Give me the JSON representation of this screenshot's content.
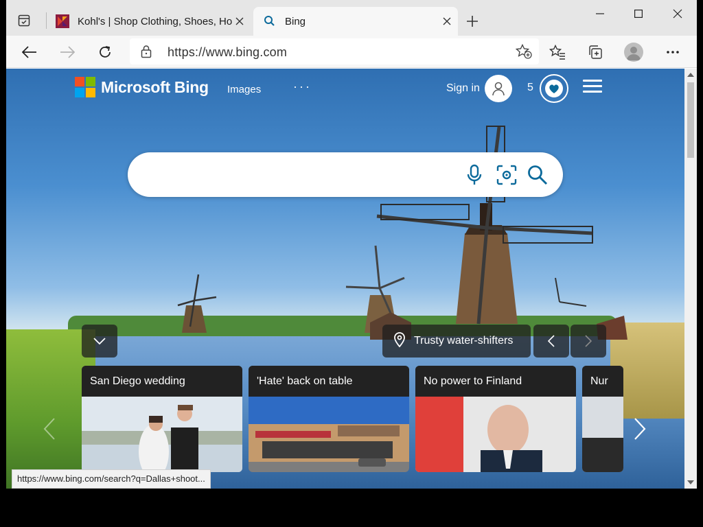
{
  "browser": {
    "tabs": [
      {
        "title": "Kohl's | Shop Clothing, Shoes, Ho",
        "active": false
      },
      {
        "title": "Bing",
        "active": true
      }
    ],
    "address": {
      "url": "https://www.bing.com"
    },
    "status_url": "https://www.bing.com/search?q=Dallas+shoot..."
  },
  "bing": {
    "brand": "Microsoft Bing",
    "nav": {
      "images": "Images",
      "more": "···"
    },
    "signin": "Sign in",
    "rewards_count": "5",
    "search": {
      "placeholder": "",
      "value": ""
    },
    "image_info": "Trusty water-shifters",
    "news": [
      {
        "headline": "San Diego wedding"
      },
      {
        "headline": "'Hate' back on table"
      },
      {
        "headline": "No power to Finland"
      },
      {
        "headline": "Nur"
      }
    ]
  },
  "colors": {
    "accent": "#0c6a9b",
    "ms_red": "#f25022",
    "ms_green": "#7fba00",
    "ms_blue": "#00a4ef",
    "ms_yellow": "#ffb900"
  }
}
